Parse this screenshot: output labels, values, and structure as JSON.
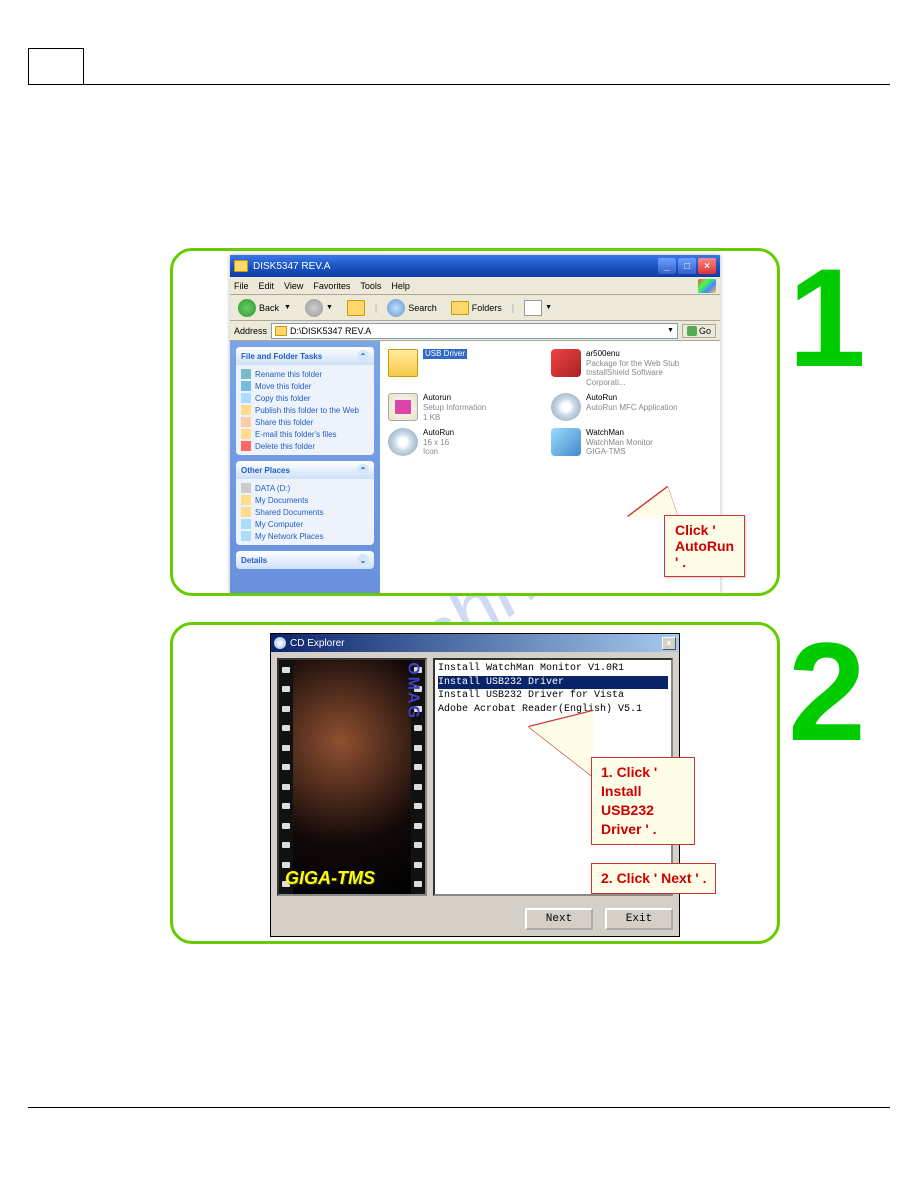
{
  "step_numbers": {
    "one": "1",
    "two": "2"
  },
  "xp": {
    "title": "DISK5347 REV.A",
    "menus": [
      "File",
      "Edit",
      "View",
      "Favorites",
      "Tools",
      "Help"
    ],
    "toolbar": {
      "back": "Back",
      "search": "Search",
      "folders": "Folders"
    },
    "address_label": "Address",
    "address_value": "D:\\DISK5347 REV.A",
    "go": "Go",
    "side_panel1": {
      "title": "File and Folder Tasks",
      "items": [
        "Rename this folder",
        "Move this folder",
        "Copy this folder",
        "Publish this folder to the Web",
        "Share this folder",
        "E-mail this folder's files",
        "Delete this folder"
      ]
    },
    "side_panel2": {
      "title": "Other Places",
      "items": [
        "DATA (D:)",
        "My Documents",
        "Shared Documents",
        "My Computer",
        "My Network Places"
      ]
    },
    "side_panel3": {
      "title": "Details"
    },
    "files": [
      {
        "name": "USB Driver",
        "sub1": "",
        "sub2": ""
      },
      {
        "name": "ar500enu",
        "sub1": "Package for the Web Stub",
        "sub2": "InstallShield Software Corporati..."
      },
      {
        "name": "Autorun",
        "sub1": "Setup Information",
        "sub2": "1 KB"
      },
      {
        "name": "AutoRun",
        "sub1": "AutoRun MFC Application",
        "sub2": ""
      },
      {
        "name": "AutoRun",
        "sub1": "16 x 16",
        "sub2": "Icon"
      },
      {
        "name": "WatchMan",
        "sub1": "WatchMan Monitor",
        "sub2": "GIGA-TMS"
      }
    ]
  },
  "callouts": {
    "c1": "Click ' AutoRun ' .",
    "c2a": "1. Click ' Install USB232 Driver ' .",
    "c2b": "2. Click ' Next ' ."
  },
  "cd": {
    "title": "CD Explorer",
    "brand_vertical": "ROMAG",
    "brand_bottom": "GIGA-TMS",
    "items": [
      "Install WatchMan Monitor V1.0R1",
      "Install USB232 Driver",
      "Install USB232 Driver for Vista",
      "Adobe Acrobat Reader(English) V5.1"
    ],
    "buttons": {
      "next": "Next",
      "exit": "Exit"
    }
  }
}
